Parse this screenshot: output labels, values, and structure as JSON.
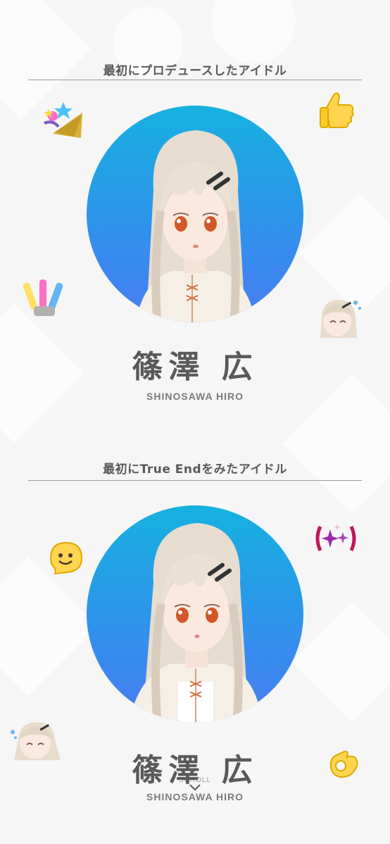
{
  "sections": [
    {
      "title": "最初にプロデュースしたアイドル",
      "idol": {
        "name_jp": "篠澤 広",
        "name_en": "SHINOSAWA HIRO"
      }
    },
    {
      "title": "最初にTrue Endをみたアイドル",
      "idol": {
        "name_jp": "篠澤 広",
        "name_en": "SHINOSAWA HIRO"
      }
    }
  ],
  "scroll_hint": {
    "label": "SCROLL",
    "icon": "chevron-down-icon"
  },
  "stickers": [
    "party-popper-icon",
    "thumbs-up-icon",
    "penlights-icon",
    "chibi-face-icon",
    "smiley-icon",
    "sparkles-icon",
    "chibi-face-icon",
    "ok-hand-icon"
  ],
  "colors": {
    "portrait_top": "#17b1df",
    "portrait_bottom": "#4a7cf2",
    "text": "#595959"
  }
}
